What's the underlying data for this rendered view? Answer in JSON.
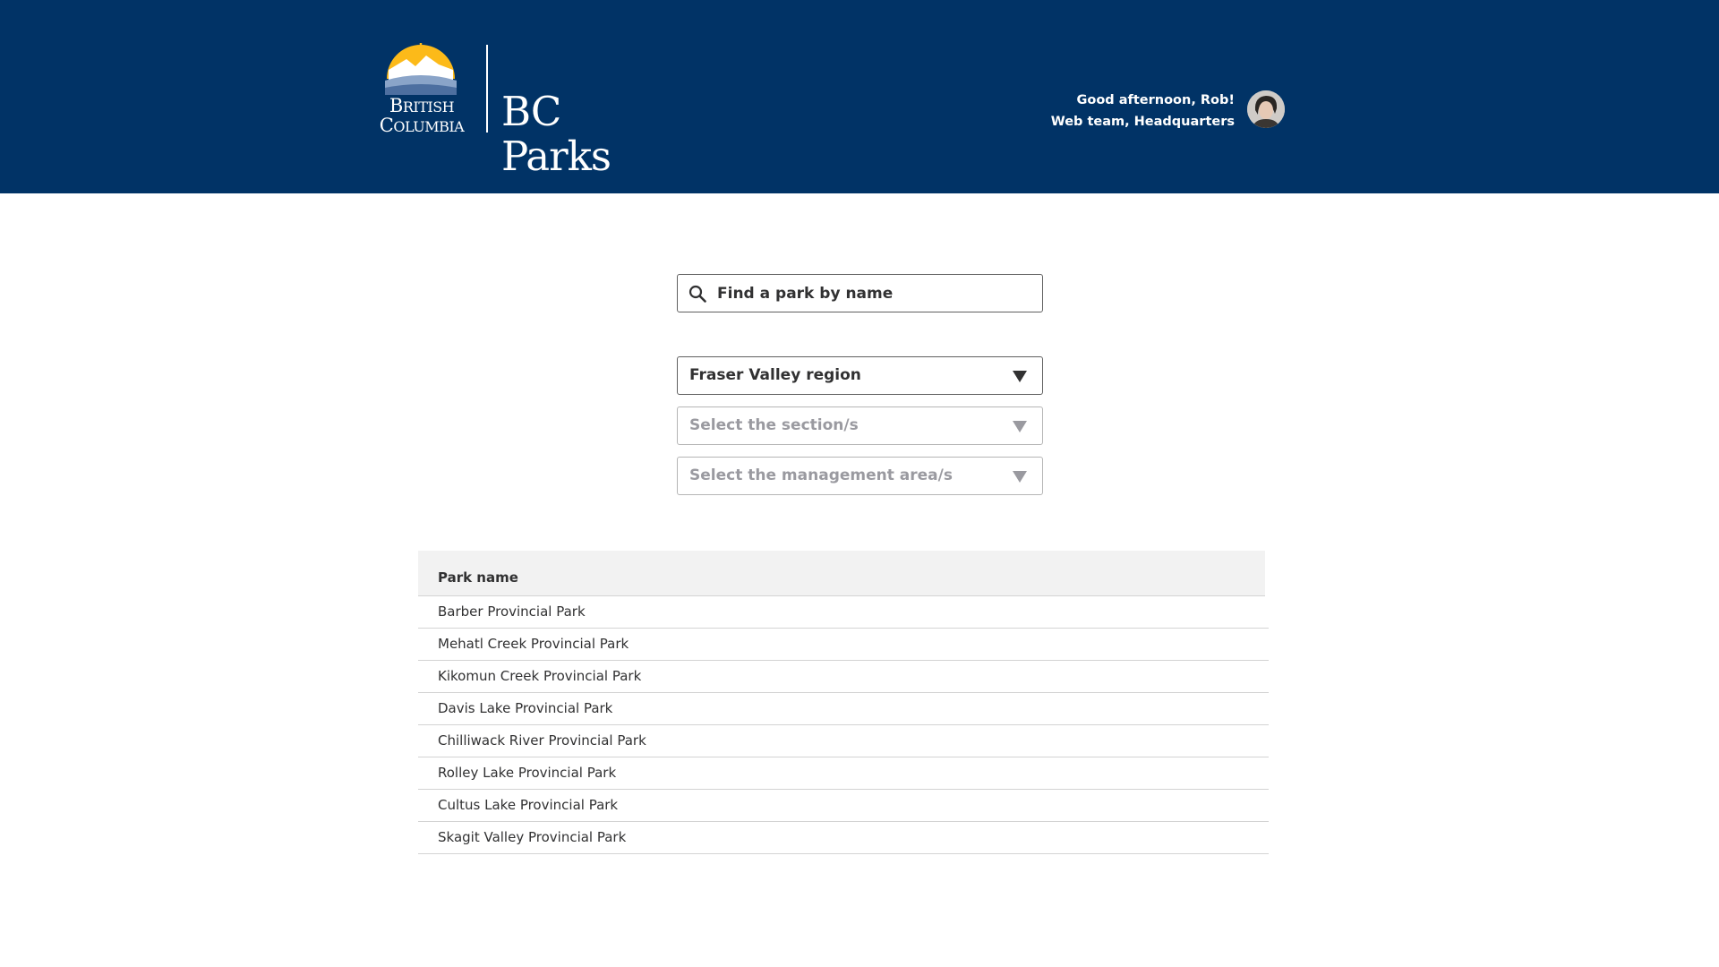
{
  "header": {
    "logo": {
      "province_wordmark": "BRITISH COLUMBIA",
      "brand_name": "BC Parks"
    },
    "user": {
      "greeting": "Good afternoon, Rob!",
      "team": "Web team, Headquarters"
    },
    "colors": {
      "background": "#013366",
      "text": "#ffffff"
    }
  },
  "search": {
    "placeholder": "Find a park by name",
    "icon": "search-icon"
  },
  "filters": {
    "region": {
      "value": "Fraser Valley region",
      "disabled": false
    },
    "section": {
      "placeholder": "Select the section/s",
      "disabled": true
    },
    "management_area": {
      "placeholder": "Select the management area/s",
      "disabled": true
    }
  },
  "table": {
    "header": "Park name",
    "rows": [
      "Barber Provincial Park",
      "Mehatl Creek Provincial Park",
      "Kikomun Creek Provincial Park",
      "Davis Lake Provincial Park",
      "Chilliwack River Provincial Park",
      "Rolley Lake Provincial Park",
      "Cultus Lake Provincial Park",
      "Skagit Valley Provincial Park"
    ]
  }
}
